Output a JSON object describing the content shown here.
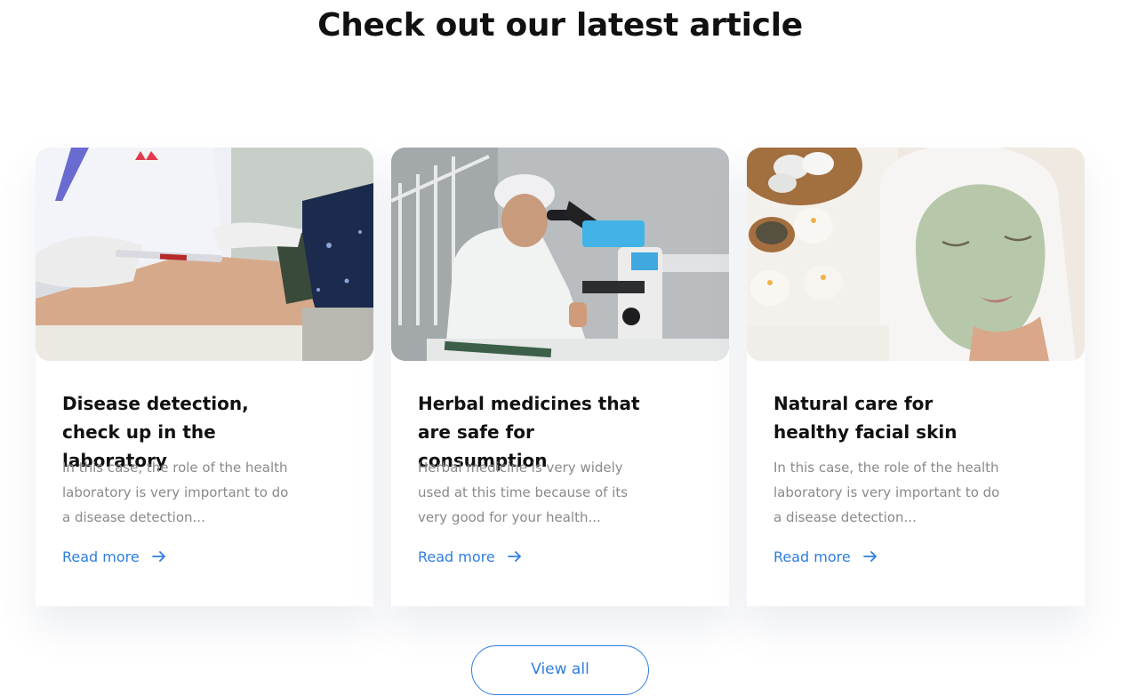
{
  "section": {
    "title": "Check out our latest article"
  },
  "articles": [
    {
      "image": "blood-test-photo",
      "title": "Disease detection, check up in the laboratory",
      "excerpt": "In this case, the role of the health laboratory is very important to do a disease detection...",
      "link": "Read more",
      "link_icon": "arrow-right-icon"
    },
    {
      "image": "microscope-scientist-photo",
      "title": "Herbal medicines that are safe for consumption",
      "excerpt": "Herbal medicine is very widely used at this time because of its very good for your health...",
      "link": "Read more",
      "link_icon": "arrow-right-icon"
    },
    {
      "image": "facial-mask-spa-photo",
      "title": "Natural care for healthy facial skin",
      "excerpt": "In this case, the role of the health laboratory is very important to do a disease detection...",
      "link": "Read more",
      "link_icon": "arrow-right-icon"
    }
  ],
  "footer": {
    "view_all": "View all"
  },
  "colors": {
    "accent": "#2f7de1",
    "title": "#111111",
    "muted": "#8a8a8a"
  }
}
